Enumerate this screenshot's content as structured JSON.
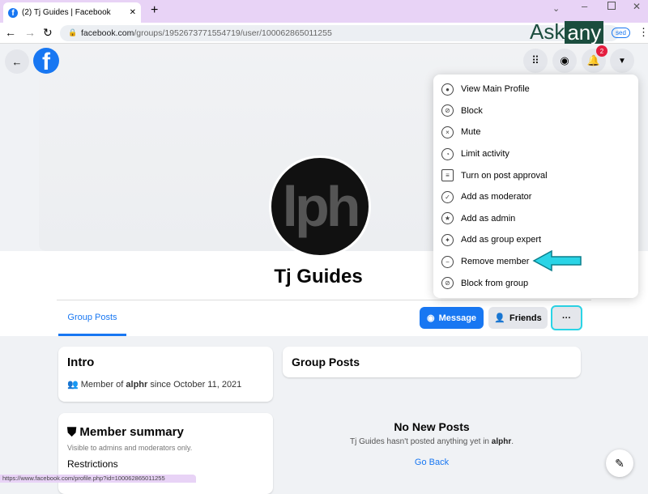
{
  "browser": {
    "tab_title": "(2) Tj Guides | Facebook",
    "url_domain": "facebook.com",
    "url_path": "/groups/1952673771554719/user/100062865011255",
    "status_url": "https://www.facebook.com/profile.php?id=100062865011255",
    "paused_label": "sed"
  },
  "watermark": {
    "ask": "Ask",
    "any": "any"
  },
  "nav": {
    "notification_count": "2"
  },
  "profile": {
    "name": "Tj Guides",
    "avatar_text": "lph"
  },
  "tabs": [
    {
      "label": "Group Posts",
      "active": true
    }
  ],
  "actions": {
    "message": "Message",
    "friends": "Friends",
    "more": "···"
  },
  "menu": {
    "items": [
      {
        "label": "View Main Profile",
        "icon": "person-circle-icon"
      },
      {
        "label": "Block",
        "icon": "block-user-icon"
      },
      {
        "label": "Mute",
        "icon": "mute-icon"
      },
      {
        "label": "Limit activity",
        "icon": "limit-icon"
      },
      {
        "label": "Turn on post approval",
        "icon": "post-approval-icon"
      },
      {
        "label": "Add as moderator",
        "icon": "shield-check-icon"
      },
      {
        "label": "Add as admin",
        "icon": "admin-star-icon"
      },
      {
        "label": "Add as group expert",
        "icon": "expert-badge-icon"
      },
      {
        "label": "Remove member",
        "icon": "remove-user-icon"
      },
      {
        "label": "Block from group",
        "icon": "block-group-icon"
      }
    ]
  },
  "intro": {
    "title": "Intro",
    "text_pre": "Member of ",
    "group": "alphr",
    "text_post": " since October 11, 2021"
  },
  "summary": {
    "title": "Member summary",
    "subtitle": "Visible to admins and moderators only.",
    "restrictions": "Restrictions"
  },
  "posts": {
    "title": "Group Posts",
    "empty_title": "No New Posts",
    "empty_pre": "Tj Guides hasn't posted anything yet in ",
    "empty_group": "alphr",
    "empty_post": ".",
    "go_back": "Go Back"
  },
  "colors": {
    "accent": "#1877f2",
    "highlight": "#2ad4e6",
    "tabbar": "#e8d3f6",
    "badge": "#e41e3f"
  }
}
